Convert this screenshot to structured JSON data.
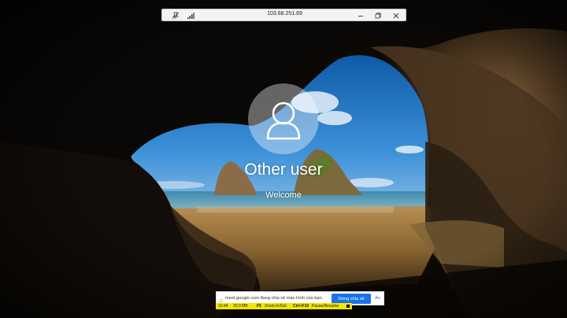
{
  "rdp_bar": {
    "title": "103.68.251.69",
    "icons": [
      "pin-icon",
      "signal-bars-icon",
      "minimize-icon",
      "restore-icon",
      "close-icon"
    ]
  },
  "login": {
    "user_name": "Other user",
    "welcome": "Welcome",
    "avatar_icon": "user-icon"
  },
  "share_notice": {
    "message": "meet.google.com đang chia sẻ màn hình của bạn.",
    "stop_button": "Dừng chia sẻ",
    "hide_link": "Ẩn"
  },
  "recorder": {
    "time": "10:44",
    "size": "20.0 MB",
    "zoom_key": "F5",
    "zoom_label": "Zoom In/Out",
    "pause_key": "Ctrl+F10",
    "pause_label": "Pause/Resume"
  },
  "colors": {
    "share_button": "#1a73e8",
    "recorder_bar": "#f3e600",
    "sky": "#2a7fd0",
    "cave_rock": "#3b2c1e"
  }
}
